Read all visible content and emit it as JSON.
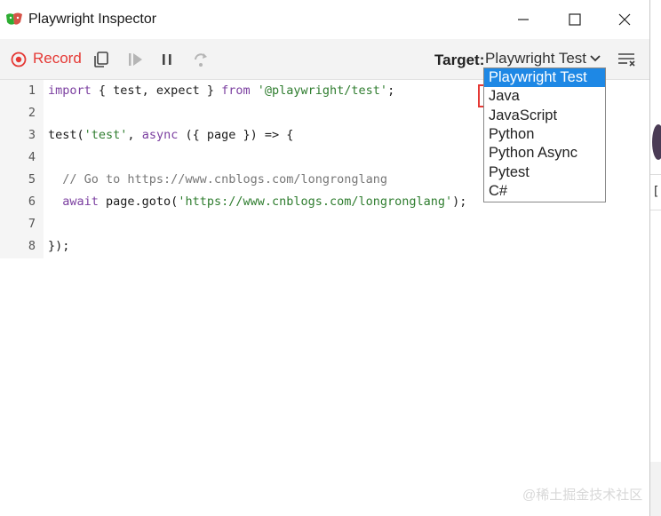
{
  "window": {
    "title": "Playwright Inspector",
    "icons": {
      "app": "playwright-logo-icon",
      "minimize": "minimize-icon",
      "maximize": "maximize-icon",
      "close": "close-icon"
    }
  },
  "toolbar": {
    "record_label": "Record",
    "target_label": "Target:",
    "target_value": "Playwright Test",
    "icons": [
      "record-icon",
      "copy-icon",
      "resume-icon",
      "pause-icon",
      "step-over-icon",
      "chevron-down-icon",
      "clear-icon"
    ]
  },
  "dropdown": {
    "options": [
      "Playwright Test",
      "Java",
      "JavaScript",
      "Python",
      "Python Async",
      "Pytest",
      "C#"
    ],
    "selected": "Playwright Test",
    "highlighted": "Java"
  },
  "editor": {
    "line_numbers": [
      "1",
      "2",
      "3",
      "4",
      "5",
      "6",
      "7",
      "8"
    ],
    "lines": [
      [
        {
          "t": "import",
          "c": "kw"
        },
        {
          "t": " { test, expect } ",
          "c": ""
        },
        {
          "t": "from",
          "c": "kw"
        },
        {
          "t": " ",
          "c": ""
        },
        {
          "t": "'@playwright/test'",
          "c": "str"
        },
        {
          "t": ";",
          "c": ""
        }
      ],
      [],
      [
        {
          "t": "test(",
          "c": ""
        },
        {
          "t": "'test'",
          "c": "str"
        },
        {
          "t": ", ",
          "c": ""
        },
        {
          "t": "async",
          "c": "kw"
        },
        {
          "t": " ({ page }) => {",
          "c": ""
        }
      ],
      [],
      [
        {
          "t": "  // Go to https://www.cnblogs.com/longronglang",
          "c": "cm"
        }
      ],
      [
        {
          "t": "  ",
          "c": ""
        },
        {
          "t": "await",
          "c": "kw"
        },
        {
          "t": " page.goto(",
          "c": ""
        },
        {
          "t": "'https://www.cnblogs.com/longronglang'",
          "c": "str"
        },
        {
          "t": ");",
          "c": ""
        }
      ],
      [],
      [
        {
          "t": "});",
          "c": ""
        }
      ]
    ]
  },
  "watermark": "@稀土掘金技术社区",
  "colors": {
    "accent": "#1e88e5",
    "record": "#e53935",
    "keyword": "#7b3fa0",
    "string": "#2f7d2f"
  }
}
